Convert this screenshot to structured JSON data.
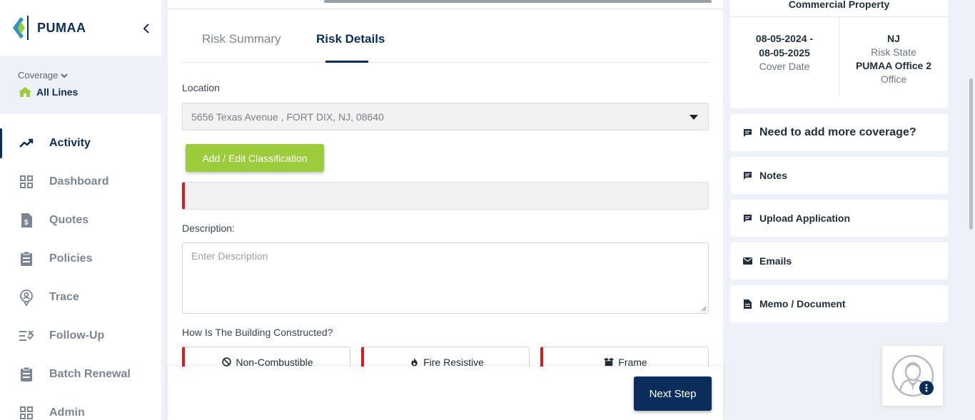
{
  "app": {
    "logo_text": "PUMAA"
  },
  "coverage": {
    "label": "Coverage",
    "value": "All Lines"
  },
  "sidebar": {
    "items": [
      {
        "label": "Activity",
        "icon": "trending-up-icon",
        "active": true
      },
      {
        "label": "Dashboard",
        "icon": "grid-icon",
        "active": false
      },
      {
        "label": "Quotes",
        "icon": "dollar-file-icon",
        "active": false
      },
      {
        "label": "Policies",
        "icon": "clipboard-icon",
        "active": false
      },
      {
        "label": "Trace",
        "icon": "location-person-icon",
        "active": false
      },
      {
        "label": "Follow-Up",
        "icon": "checklist-icon",
        "active": false
      },
      {
        "label": "Batch Renewal",
        "icon": "clipboard-icon",
        "active": false
      },
      {
        "label": "Admin",
        "icon": "grid-icon",
        "active": false
      }
    ]
  },
  "tabs": [
    {
      "label": "Risk Summary",
      "active": false
    },
    {
      "label": "Risk Details",
      "active": true
    }
  ],
  "form": {
    "location_label": "Location",
    "location_value": "5656 Texas Avenue , FORT DIX, NJ, 08640",
    "classification_button": "Add / Edit Classification",
    "description_label": "Description:",
    "description_placeholder": "Enter Description",
    "construction_question": "How Is The Building Constructed?",
    "construction_options": [
      "Non-Combustible",
      "Fire Resistive",
      "Frame"
    ]
  },
  "footer": {
    "next_button": "Next Step"
  },
  "policy_card": {
    "title": "Commercial Property",
    "date_line1": "08-05-2024 -",
    "date_line2": "08-05-2025",
    "date_caption": "Cover Date",
    "state": "NJ",
    "state_caption": "Risk State",
    "office": "PUMAA Office 2",
    "office_caption": "Office"
  },
  "side_actions": [
    {
      "label": "Need to add more coverage?",
      "icon": "chat-icon"
    },
    {
      "label": "Notes",
      "icon": "chat-icon"
    },
    {
      "label": "Upload Application",
      "icon": "chat-icon"
    },
    {
      "label": "Emails",
      "icon": "mail-icon"
    },
    {
      "label": "Memo / Document",
      "icon": "document-icon"
    }
  ],
  "colors": {
    "brand_navy": "#0b2d5b",
    "accent_green": "#9ccc3c",
    "required_red": "#e0191e"
  }
}
